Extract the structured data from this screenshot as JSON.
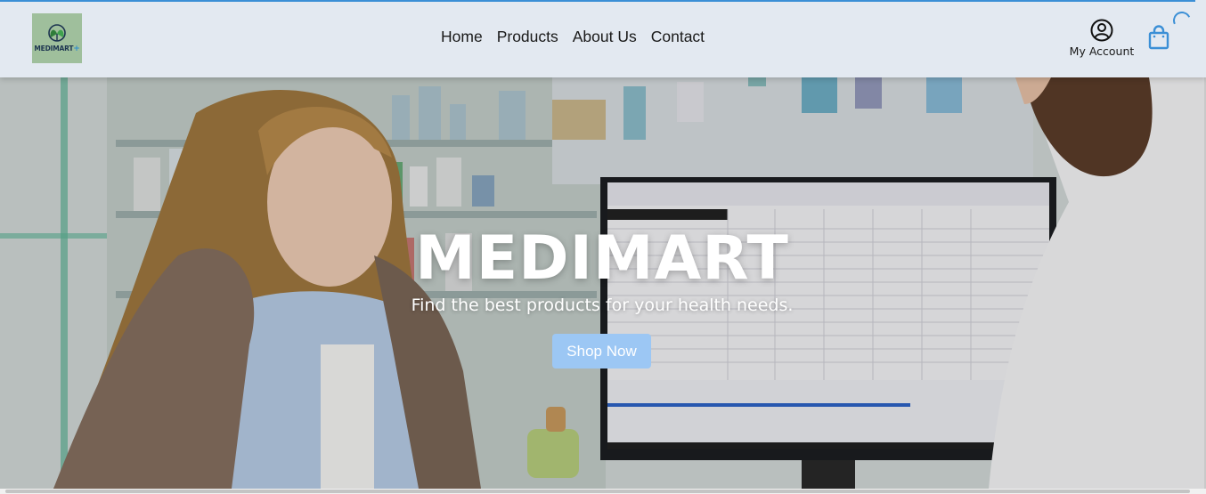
{
  "header": {
    "logo_text": "MEDIMART",
    "logo_plus": "+",
    "nav": [
      {
        "label": "Home"
      },
      {
        "label": "Products"
      },
      {
        "label": "About Us"
      },
      {
        "label": "Contact"
      }
    ],
    "account_label": "My Account",
    "account_icon": "user-circle-icon",
    "cart_icon": "shopping-bag-icon"
  },
  "hero": {
    "title": "MEDIMART",
    "subtitle": "Find the best products for your health needs.",
    "button_label": "Shop Now"
  },
  "colors": {
    "header_bg": "#e3e9f1",
    "accent": "#3b8fd6",
    "button_bg": "#9cc7f4",
    "logo_bg": "#9fbf9c"
  }
}
